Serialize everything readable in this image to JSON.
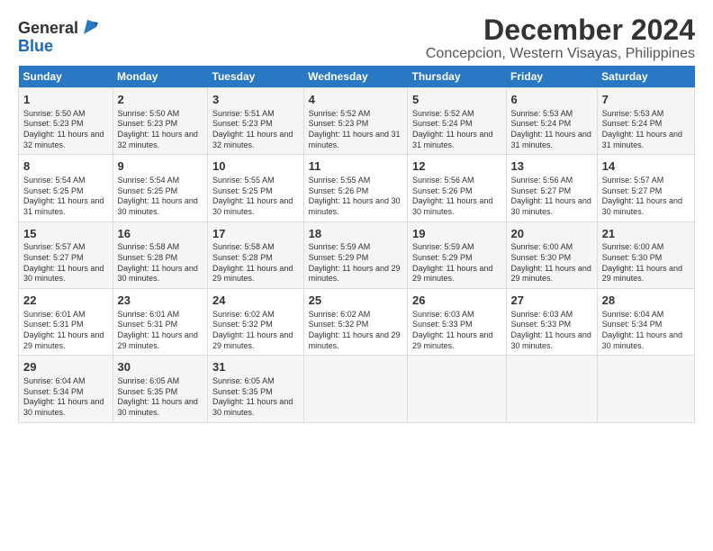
{
  "logo": {
    "general": "General",
    "blue": "Blue"
  },
  "title": "December 2024",
  "subtitle": "Concepcion, Western Visayas, Philippines",
  "days_header": [
    "Sunday",
    "Monday",
    "Tuesday",
    "Wednesday",
    "Thursday",
    "Friday",
    "Saturday"
  ],
  "weeks": [
    [
      {
        "day": "1",
        "sunrise": "Sunrise: 5:50 AM",
        "sunset": "Sunset: 5:23 PM",
        "daylight": "Daylight: 11 hours and 32 minutes."
      },
      {
        "day": "2",
        "sunrise": "Sunrise: 5:50 AM",
        "sunset": "Sunset: 5:23 PM",
        "daylight": "Daylight: 11 hours and 32 minutes."
      },
      {
        "day": "3",
        "sunrise": "Sunrise: 5:51 AM",
        "sunset": "Sunset: 5:23 PM",
        "daylight": "Daylight: 11 hours and 32 minutes."
      },
      {
        "day": "4",
        "sunrise": "Sunrise: 5:52 AM",
        "sunset": "Sunset: 5:23 PM",
        "daylight": "Daylight: 11 hours and 31 minutes."
      },
      {
        "day": "5",
        "sunrise": "Sunrise: 5:52 AM",
        "sunset": "Sunset: 5:24 PM",
        "daylight": "Daylight: 11 hours and 31 minutes."
      },
      {
        "day": "6",
        "sunrise": "Sunrise: 5:53 AM",
        "sunset": "Sunset: 5:24 PM",
        "daylight": "Daylight: 11 hours and 31 minutes."
      },
      {
        "day": "7",
        "sunrise": "Sunrise: 5:53 AM",
        "sunset": "Sunset: 5:24 PM",
        "daylight": "Daylight: 11 hours and 31 minutes."
      }
    ],
    [
      {
        "day": "8",
        "sunrise": "Sunrise: 5:54 AM",
        "sunset": "Sunset: 5:25 PM",
        "daylight": "Daylight: 11 hours and 31 minutes."
      },
      {
        "day": "9",
        "sunrise": "Sunrise: 5:54 AM",
        "sunset": "Sunset: 5:25 PM",
        "daylight": "Daylight: 11 hours and 30 minutes."
      },
      {
        "day": "10",
        "sunrise": "Sunrise: 5:55 AM",
        "sunset": "Sunset: 5:25 PM",
        "daylight": "Daylight: 11 hours and 30 minutes."
      },
      {
        "day": "11",
        "sunrise": "Sunrise: 5:55 AM",
        "sunset": "Sunset: 5:26 PM",
        "daylight": "Daylight: 11 hours and 30 minutes."
      },
      {
        "day": "12",
        "sunrise": "Sunrise: 5:56 AM",
        "sunset": "Sunset: 5:26 PM",
        "daylight": "Daylight: 11 hours and 30 minutes."
      },
      {
        "day": "13",
        "sunrise": "Sunrise: 5:56 AM",
        "sunset": "Sunset: 5:27 PM",
        "daylight": "Daylight: 11 hours and 30 minutes."
      },
      {
        "day": "14",
        "sunrise": "Sunrise: 5:57 AM",
        "sunset": "Sunset: 5:27 PM",
        "daylight": "Daylight: 11 hours and 30 minutes."
      }
    ],
    [
      {
        "day": "15",
        "sunrise": "Sunrise: 5:57 AM",
        "sunset": "Sunset: 5:27 PM",
        "daylight": "Daylight: 11 hours and 30 minutes."
      },
      {
        "day": "16",
        "sunrise": "Sunrise: 5:58 AM",
        "sunset": "Sunset: 5:28 PM",
        "daylight": "Daylight: 11 hours and 30 minutes."
      },
      {
        "day": "17",
        "sunrise": "Sunrise: 5:58 AM",
        "sunset": "Sunset: 5:28 PM",
        "daylight": "Daylight: 11 hours and 29 minutes."
      },
      {
        "day": "18",
        "sunrise": "Sunrise: 5:59 AM",
        "sunset": "Sunset: 5:29 PM",
        "daylight": "Daylight: 11 hours and 29 minutes."
      },
      {
        "day": "19",
        "sunrise": "Sunrise: 5:59 AM",
        "sunset": "Sunset: 5:29 PM",
        "daylight": "Daylight: 11 hours and 29 minutes."
      },
      {
        "day": "20",
        "sunrise": "Sunrise: 6:00 AM",
        "sunset": "Sunset: 5:30 PM",
        "daylight": "Daylight: 11 hours and 29 minutes."
      },
      {
        "day": "21",
        "sunrise": "Sunrise: 6:00 AM",
        "sunset": "Sunset: 5:30 PM",
        "daylight": "Daylight: 11 hours and 29 minutes."
      }
    ],
    [
      {
        "day": "22",
        "sunrise": "Sunrise: 6:01 AM",
        "sunset": "Sunset: 5:31 PM",
        "daylight": "Daylight: 11 hours and 29 minutes."
      },
      {
        "day": "23",
        "sunrise": "Sunrise: 6:01 AM",
        "sunset": "Sunset: 5:31 PM",
        "daylight": "Daylight: 11 hours and 29 minutes."
      },
      {
        "day": "24",
        "sunrise": "Sunrise: 6:02 AM",
        "sunset": "Sunset: 5:32 PM",
        "daylight": "Daylight: 11 hours and 29 minutes."
      },
      {
        "day": "25",
        "sunrise": "Sunrise: 6:02 AM",
        "sunset": "Sunset: 5:32 PM",
        "daylight": "Daylight: 11 hours and 29 minutes."
      },
      {
        "day": "26",
        "sunrise": "Sunrise: 6:03 AM",
        "sunset": "Sunset: 5:33 PM",
        "daylight": "Daylight: 11 hours and 29 minutes."
      },
      {
        "day": "27",
        "sunrise": "Sunrise: 6:03 AM",
        "sunset": "Sunset: 5:33 PM",
        "daylight": "Daylight: 11 hours and 30 minutes."
      },
      {
        "day": "28",
        "sunrise": "Sunrise: 6:04 AM",
        "sunset": "Sunset: 5:34 PM",
        "daylight": "Daylight: 11 hours and 30 minutes."
      }
    ],
    [
      {
        "day": "29",
        "sunrise": "Sunrise: 6:04 AM",
        "sunset": "Sunset: 5:34 PM",
        "daylight": "Daylight: 11 hours and 30 minutes."
      },
      {
        "day": "30",
        "sunrise": "Sunrise: 6:05 AM",
        "sunset": "Sunset: 5:35 PM",
        "daylight": "Daylight: 11 hours and 30 minutes."
      },
      {
        "day": "31",
        "sunrise": "Sunrise: 6:05 AM",
        "sunset": "Sunset: 5:35 PM",
        "daylight": "Daylight: 11 hours and 30 minutes."
      },
      null,
      null,
      null,
      null
    ]
  ]
}
